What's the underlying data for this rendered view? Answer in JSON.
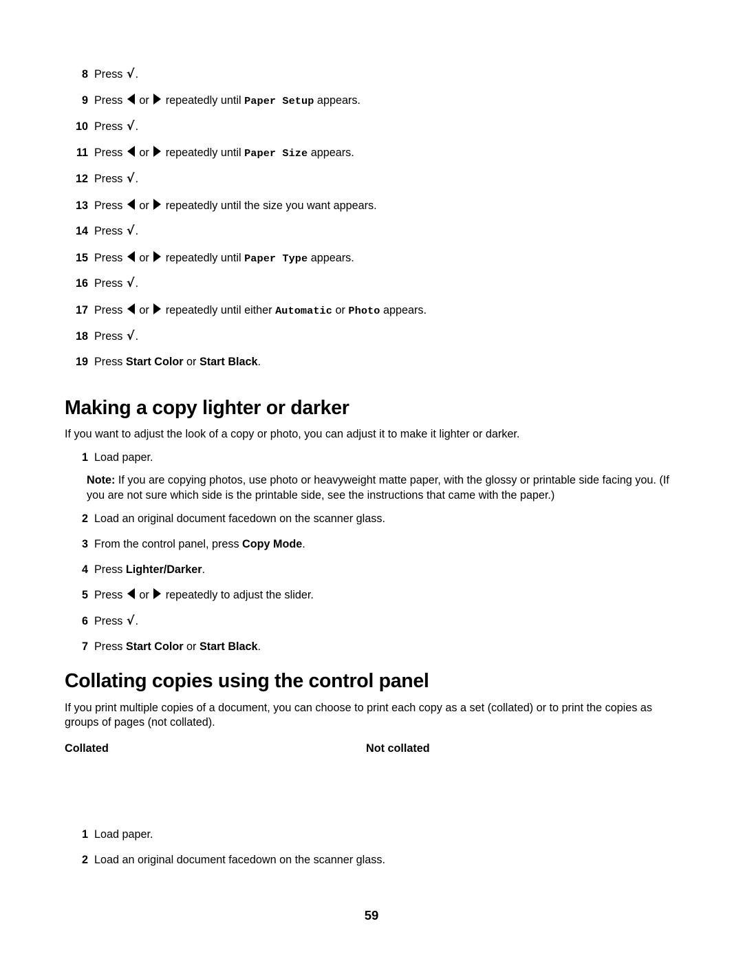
{
  "page": {
    "number": "59"
  },
  "steps_top": [
    {
      "num": "8",
      "parts": [
        {
          "t": "text",
          "v": "Press "
        },
        {
          "t": "check"
        },
        {
          "t": "text",
          "v": "."
        }
      ]
    },
    {
      "num": "9",
      "parts": [
        {
          "t": "text",
          "v": "Press "
        },
        {
          "t": "arrow-left"
        },
        {
          "t": "text",
          "v": " or "
        },
        {
          "t": "arrow-right"
        },
        {
          "t": "text",
          "v": " repeatedly until "
        },
        {
          "t": "mono",
          "v": "Paper Setup"
        },
        {
          "t": "text",
          "v": " appears."
        }
      ]
    },
    {
      "num": "10",
      "parts": [
        {
          "t": "text",
          "v": "Press "
        },
        {
          "t": "check"
        },
        {
          "t": "text",
          "v": "."
        }
      ]
    },
    {
      "num": "11",
      "parts": [
        {
          "t": "text",
          "v": "Press "
        },
        {
          "t": "arrow-left"
        },
        {
          "t": "text",
          "v": " or "
        },
        {
          "t": "arrow-right"
        },
        {
          "t": "text",
          "v": " repeatedly until "
        },
        {
          "t": "mono",
          "v": "Paper Size"
        },
        {
          "t": "text",
          "v": " appears."
        }
      ]
    },
    {
      "num": "12",
      "parts": [
        {
          "t": "text",
          "v": "Press "
        },
        {
          "t": "check"
        },
        {
          "t": "text",
          "v": "."
        }
      ]
    },
    {
      "num": "13",
      "parts": [
        {
          "t": "text",
          "v": "Press "
        },
        {
          "t": "arrow-left"
        },
        {
          "t": "text",
          "v": " or "
        },
        {
          "t": "arrow-right"
        },
        {
          "t": "text",
          "v": " repeatedly until the size you want appears."
        }
      ]
    },
    {
      "num": "14",
      "parts": [
        {
          "t": "text",
          "v": "Press "
        },
        {
          "t": "check"
        },
        {
          "t": "text",
          "v": "."
        }
      ]
    },
    {
      "num": "15",
      "parts": [
        {
          "t": "text",
          "v": "Press "
        },
        {
          "t": "arrow-left"
        },
        {
          "t": "text",
          "v": " or "
        },
        {
          "t": "arrow-right"
        },
        {
          "t": "text",
          "v": " repeatedly until "
        },
        {
          "t": "mono",
          "v": "Paper Type"
        },
        {
          "t": "text",
          "v": " appears."
        }
      ]
    },
    {
      "num": "16",
      "parts": [
        {
          "t": "text",
          "v": "Press "
        },
        {
          "t": "check"
        },
        {
          "t": "text",
          "v": "."
        }
      ]
    },
    {
      "num": "17",
      "parts": [
        {
          "t": "text",
          "v": "Press "
        },
        {
          "t": "arrow-left"
        },
        {
          "t": "text",
          "v": " or "
        },
        {
          "t": "arrow-right"
        },
        {
          "t": "text",
          "v": " repeatedly until either "
        },
        {
          "t": "mono",
          "v": "Automatic"
        },
        {
          "t": "text",
          "v": " or "
        },
        {
          "t": "mono",
          "v": "Photo"
        },
        {
          "t": "text",
          "v": " appears."
        }
      ]
    },
    {
      "num": "18",
      "parts": [
        {
          "t": "text",
          "v": "Press "
        },
        {
          "t": "check"
        },
        {
          "t": "text",
          "v": "."
        }
      ]
    },
    {
      "num": "19",
      "parts": [
        {
          "t": "text",
          "v": "Press "
        },
        {
          "t": "bold",
          "v": "Start Color"
        },
        {
          "t": "text",
          "v": " or "
        },
        {
          "t": "bold",
          "v": "Start Black"
        },
        {
          "t": "text",
          "v": "."
        }
      ]
    }
  ],
  "lighter_section": {
    "heading": "Making a copy lighter or darker",
    "intro": "If you want to adjust the look of a copy or photo, you can adjust it to make it lighter or darker.",
    "step1": {
      "num": "1",
      "parts": [
        {
          "t": "text",
          "v": "Load paper."
        }
      ]
    },
    "note": {
      "label": "Note:",
      "text": " If you are copying photos, use photo or heavyweight matte paper, with the glossy or printable side facing you. (If you are not sure which side is the printable side, see the instructions that came with the paper.)"
    },
    "steps": [
      {
        "num": "2",
        "parts": [
          {
            "t": "text",
            "v": "Load an original document facedown on the scanner glass."
          }
        ]
      },
      {
        "num": "3",
        "parts": [
          {
            "t": "text",
            "v": "From the control panel, press "
          },
          {
            "t": "bold",
            "v": "Copy Mode"
          },
          {
            "t": "text",
            "v": "."
          }
        ]
      },
      {
        "num": "4",
        "parts": [
          {
            "t": "text",
            "v": "Press "
          },
          {
            "t": "bold",
            "v": "Lighter/Darker"
          },
          {
            "t": "text",
            "v": "."
          }
        ]
      },
      {
        "num": "5",
        "parts": [
          {
            "t": "text",
            "v": "Press "
          },
          {
            "t": "arrow-left"
          },
          {
            "t": "text",
            "v": " or "
          },
          {
            "t": "arrow-right"
          },
          {
            "t": "text",
            "v": " repeatedly to adjust the slider."
          }
        ]
      },
      {
        "num": "6",
        "parts": [
          {
            "t": "text",
            "v": "Press "
          },
          {
            "t": "check"
          },
          {
            "t": "text",
            "v": "."
          }
        ]
      },
      {
        "num": "7",
        "parts": [
          {
            "t": "text",
            "v": "Press "
          },
          {
            "t": "bold",
            "v": "Start Color"
          },
          {
            "t": "text",
            "v": " or "
          },
          {
            "t": "bold",
            "v": "Start Black"
          },
          {
            "t": "text",
            "v": "."
          }
        ]
      }
    ]
  },
  "collating_section": {
    "heading": "Collating copies using the control panel",
    "intro": "If you print multiple copies of a document, you can choose to print each copy as a set (collated) or to print the copies as groups of pages (not collated).",
    "column_labels": {
      "collated": "Collated",
      "not_collated": "Not collated"
    },
    "steps": [
      {
        "num": "1",
        "parts": [
          {
            "t": "text",
            "v": "Load paper."
          }
        ]
      },
      {
        "num": "2",
        "parts": [
          {
            "t": "text",
            "v": "Load an original document facedown on the scanner glass."
          }
        ]
      }
    ]
  }
}
